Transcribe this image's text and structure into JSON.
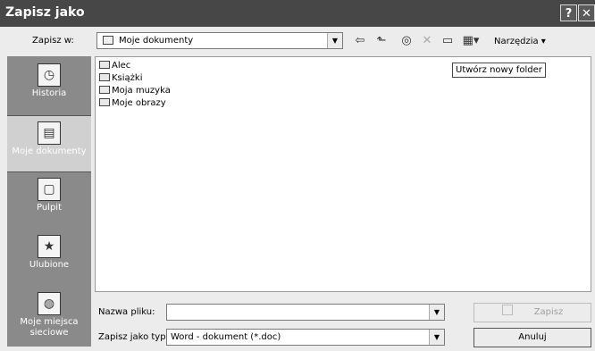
{
  "window": {
    "title": "Zapisz jako",
    "help_btn": "?",
    "close_btn": "✕"
  },
  "location": {
    "label": "Zapisz w:",
    "value": "Moje dokumenty"
  },
  "toolbar": {
    "tools_label": "Narzędzia",
    "icons": [
      "back-icon",
      "up-folder-icon",
      "search-web-icon",
      "delete-icon",
      "new-folder-icon",
      "views-icon"
    ]
  },
  "places": [
    {
      "label": "Historia",
      "icon": "history-icon"
    },
    {
      "label": "Moje dokumenty",
      "icon": "my-documents-icon"
    },
    {
      "label": "Pulpit",
      "icon": "desktop-icon"
    },
    {
      "label": "Ulubione",
      "icon": "favorites-icon"
    },
    {
      "label": "Moje miejsca sieciowe",
      "icon": "network-places-icon"
    }
  ],
  "files": [
    {
      "name": "Alec",
      "icon": "folder-icon"
    },
    {
      "name": "Książki",
      "icon": "folder-icon"
    },
    {
      "name": "Moja muzyka",
      "icon": "music-folder-icon"
    },
    {
      "name": "Moje obrazy",
      "icon": "pictures-folder-icon"
    }
  ],
  "tooltip": "Utwórz nowy folder",
  "filename": {
    "label": "Nazwa pliku:",
    "value": ""
  },
  "filetype": {
    "label": "Zapisz jako typ:",
    "value": "Word - dokument (*.doc)"
  },
  "buttons": {
    "save": "Zapisz",
    "cancel": "Anuluj"
  }
}
